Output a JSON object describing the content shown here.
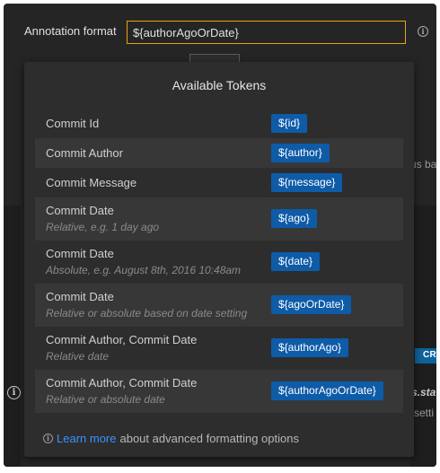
{
  "settings": {
    "format_label": "Annotation format",
    "format_value": "${authorAgoOrDate}",
    "info_icon": "info-icon"
  },
  "background": {
    "partial_text_1": "us ba",
    "partial_text_2": "s.sta",
    "partial_text_3": "setti",
    "badge_text": "CRL"
  },
  "popup": {
    "title": "Available Tokens",
    "rows": [
      {
        "label": "Commit Id",
        "desc": "",
        "token": "${id}"
      },
      {
        "label": "Commit Author",
        "desc": "",
        "token": "${author}"
      },
      {
        "label": "Commit Message",
        "desc": "",
        "token": "${message}"
      },
      {
        "label": "Commit Date",
        "desc": "Relative, e.g. 1 day ago",
        "token": "${ago}"
      },
      {
        "label": "Commit Date",
        "desc": "Absolute, e.g. August 8th, 2016 10:48am",
        "token": "${date}"
      },
      {
        "label": "Commit Date",
        "desc": "Relative or absolute based on date setting",
        "token": "${agoOrDate}"
      },
      {
        "label": "Commit Author, Commit Date",
        "desc": "Relative date",
        "token": "${authorAgo}"
      },
      {
        "label": "Commit Author, Commit Date",
        "desc": "Relative or absolute date",
        "token": "${authorAgoOrDate}"
      }
    ],
    "footer": {
      "link_text": "Learn more",
      "rest_text": "about advanced formatting options"
    }
  }
}
